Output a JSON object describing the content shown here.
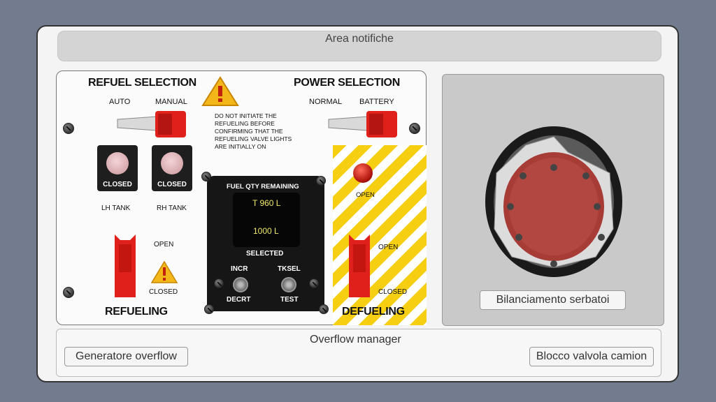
{
  "notifications": {
    "label": "Area notifiche"
  },
  "refuel_selection": {
    "title": "REFUEL SELECTION",
    "auto_label": "AUTO",
    "manual_label": "MANUAL"
  },
  "warning_text": [
    "DO NOT INITIATE THE",
    "REFUELING BEFORE",
    "CONFIRMING THAT THE",
    "REFUELING VALVE LIGHTS",
    "ARE INITIALLY ON"
  ],
  "power_selection": {
    "title": "POWER SELECTION",
    "normal_label": "NORMAL",
    "battery_label": "BATTERY"
  },
  "valve_lights": {
    "lh_status": "CLOSED",
    "rh_status": "CLOSED",
    "lh_label": "LH TANK",
    "rh_label": "RH TANK"
  },
  "refueling": {
    "title": "REFUELING",
    "open_label": "OPEN",
    "closed_label": "CLOSED"
  },
  "fuel_gauge": {
    "title": "FUEL QTY REMAINING",
    "total_value": "T 960 L",
    "selected_value": "1000 L",
    "selected_label": "SELECTED",
    "incr_label": "INCR",
    "decrt_label": "DECRT",
    "tksel_label": "TKSEL",
    "test_label": "TEST"
  },
  "defueling": {
    "title": "DEFUELING",
    "light_label": "OPEN",
    "open_label": "OPEN",
    "closed_label": "CLOSED"
  },
  "balancing": {
    "button_label": "Bilanciamento serbatoi"
  },
  "overflow": {
    "title": "Overflow manager",
    "generator_label": "Generatore overflow",
    "block_label": "Blocco valvola camion"
  },
  "colors": {
    "accent_red": "#e0201a",
    "hazard_yellow": "#f6cf12",
    "gauge_text": "#f2e86a"
  }
}
